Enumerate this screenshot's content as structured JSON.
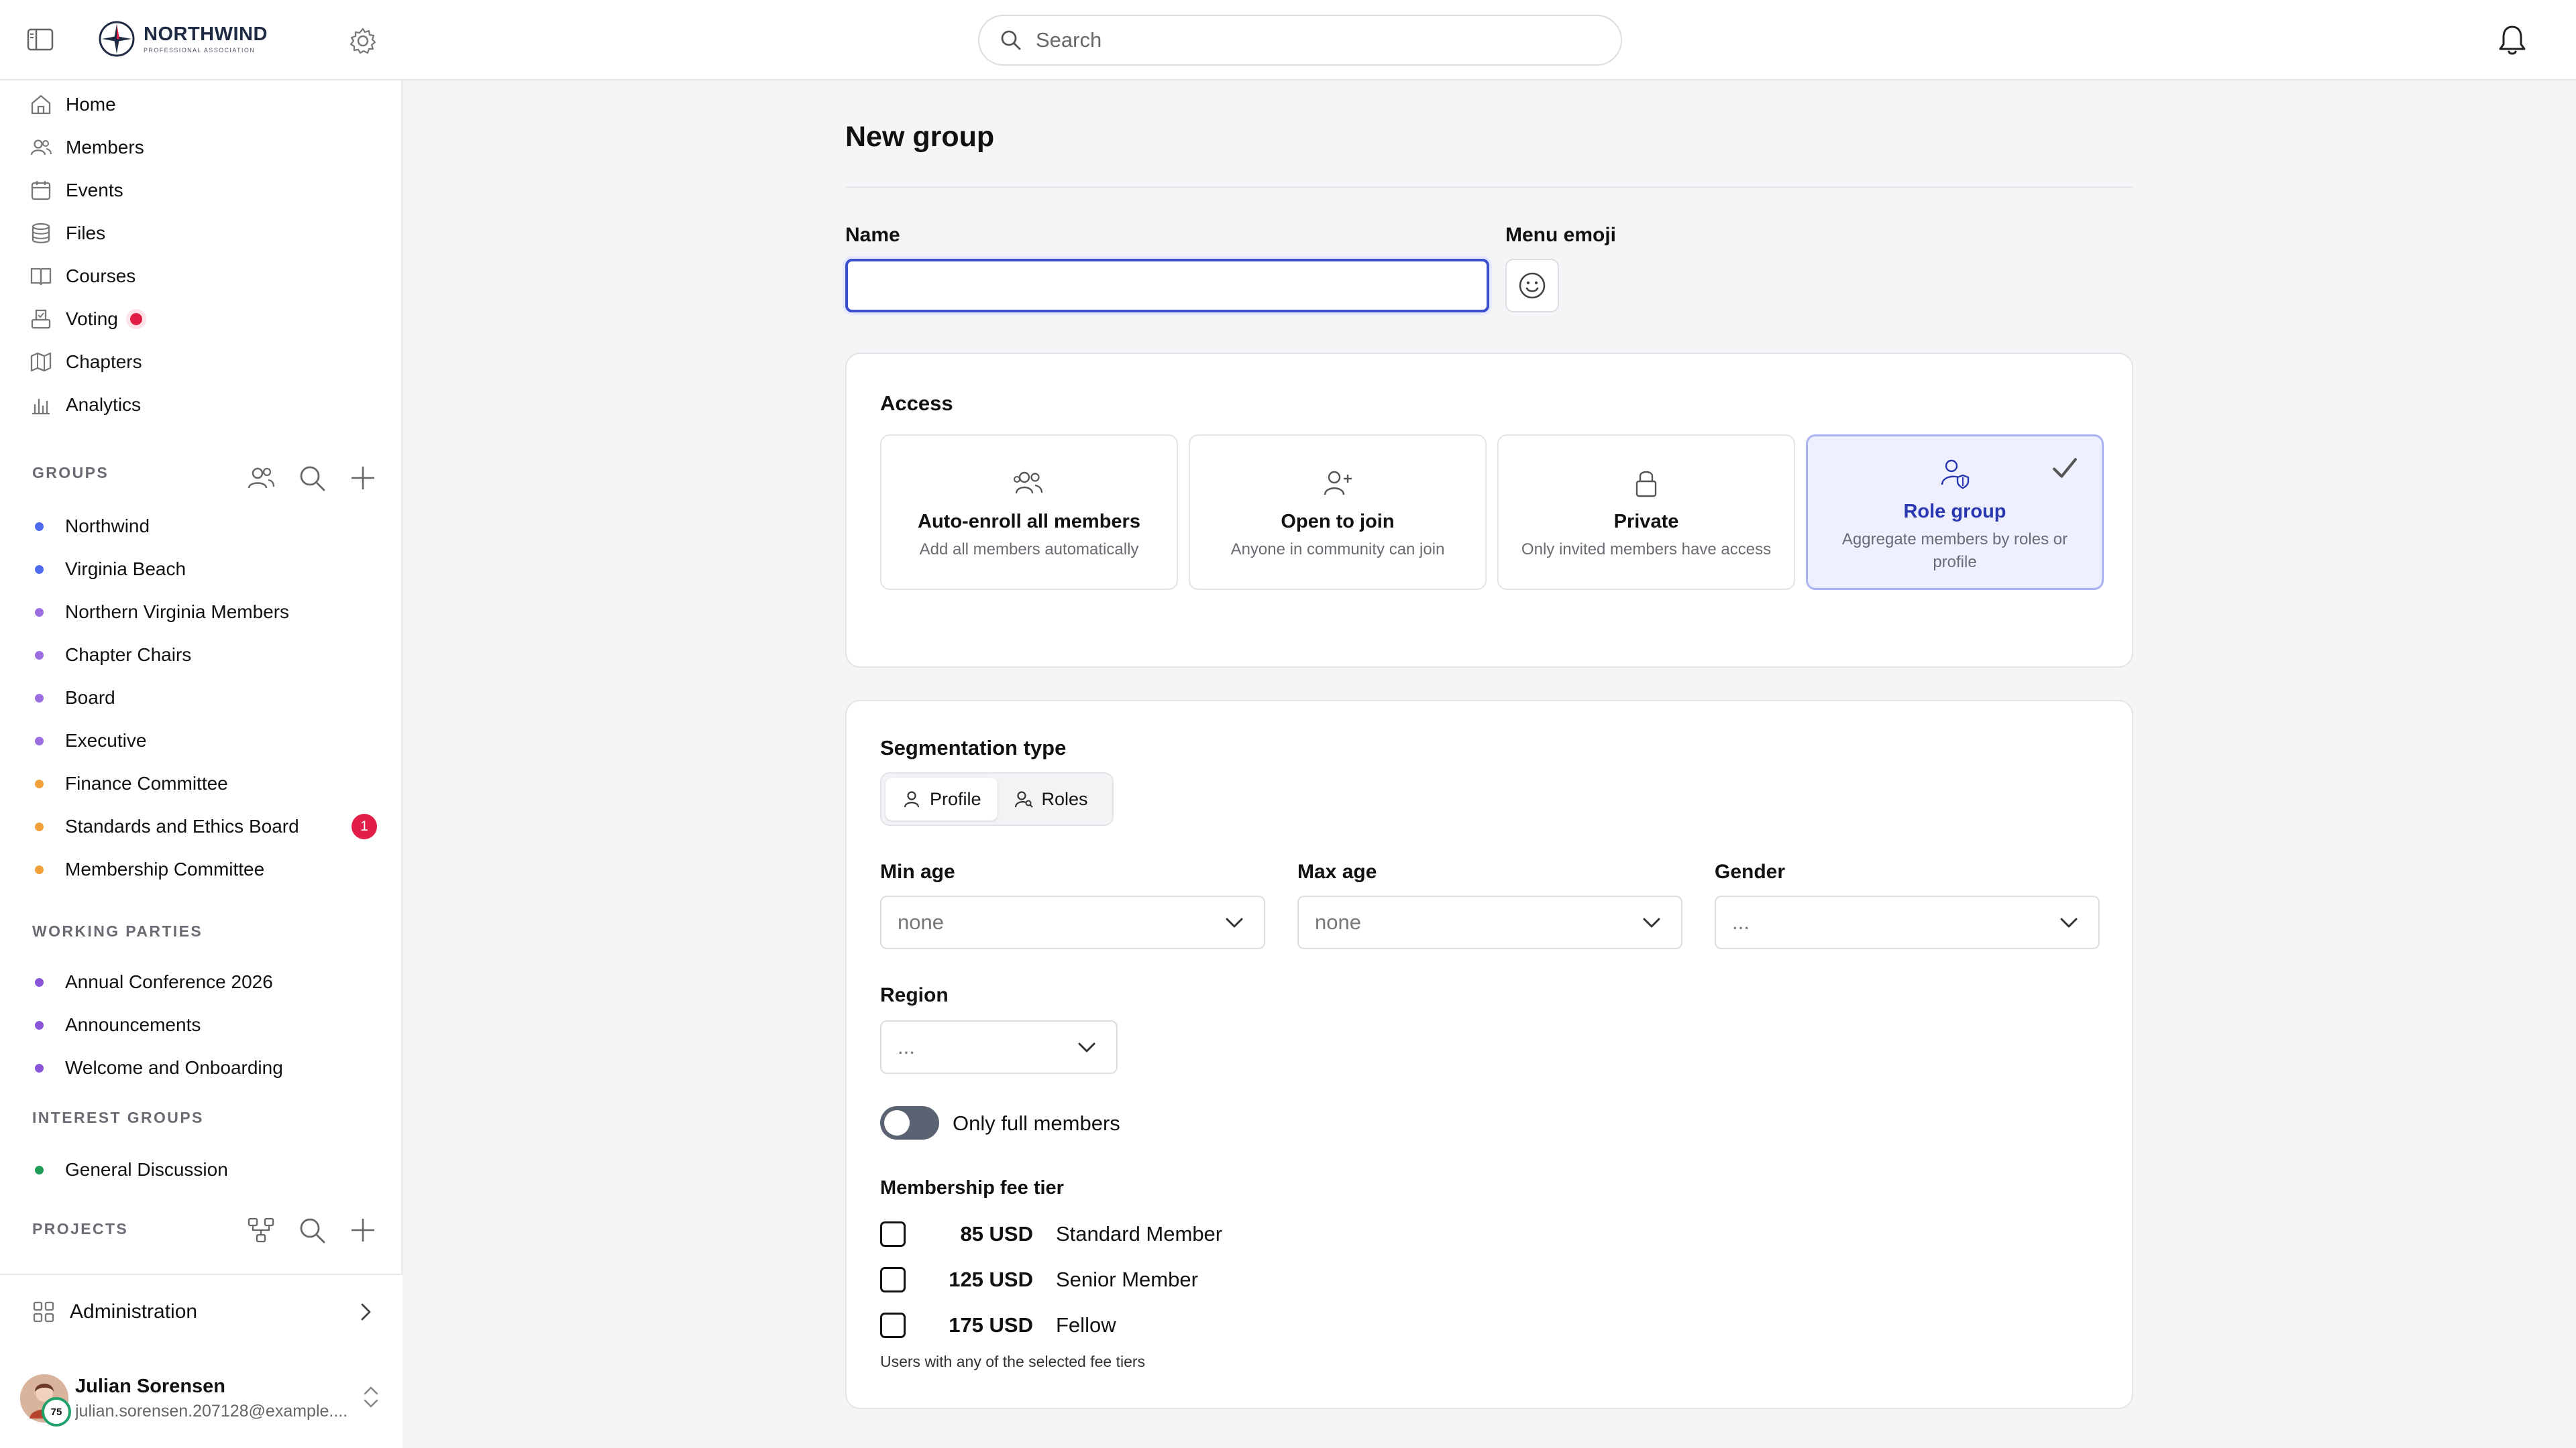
{
  "app": {
    "brand_name": "NORTHWIND",
    "brand_subtitle": "PROFESSIONAL ASSOCIATION",
    "search_placeholder": "Search"
  },
  "nav": [
    {
      "label": "Home",
      "icon": "home-icon"
    },
    {
      "label": "Members",
      "icon": "members-icon"
    },
    {
      "label": "Events",
      "icon": "calendar-icon"
    },
    {
      "label": "Files",
      "icon": "database-icon"
    },
    {
      "label": "Courses",
      "icon": "book-icon"
    },
    {
      "label": "Voting",
      "icon": "ballot-icon",
      "has_alert": true
    },
    {
      "label": "Chapters",
      "icon": "map-icon"
    },
    {
      "label": "Analytics",
      "icon": "chart-icon"
    }
  ],
  "sections": {
    "groups": {
      "label": "GROUPS",
      "items": [
        {
          "label": "Northwind",
          "color": "#4f6bed"
        },
        {
          "label": "Virginia Beach",
          "color": "#4f6bed"
        },
        {
          "label": "Northern Virginia Members",
          "color": "#9b6fe0"
        },
        {
          "label": "Chapter Chairs",
          "color": "#9b6fe0"
        },
        {
          "label": "Board",
          "color": "#9b6fe0"
        },
        {
          "label": "Executive",
          "color": "#9b6fe0"
        },
        {
          "label": "Finance Committee",
          "color": "#f0a13a"
        },
        {
          "label": "Standards and Ethics Board",
          "color": "#f0a13a",
          "badge": "1"
        },
        {
          "label": "Membership Committee",
          "color": "#f0a13a"
        }
      ]
    },
    "working_parties": {
      "label": "WORKING PARTIES",
      "items": [
        {
          "label": "Annual Conference 2026",
          "color": "#8a55d8"
        },
        {
          "label": "Announcements",
          "color": "#8a55d8"
        },
        {
          "label": "Welcome and Onboarding",
          "color": "#8a55d8"
        }
      ]
    },
    "interest_groups": {
      "label": "INTEREST GROUPS",
      "items": [
        {
          "label": "General Discussion",
          "color": "#1f9d55"
        }
      ]
    },
    "projects": {
      "label": "PROJECTS"
    }
  },
  "footer": {
    "admin_label": "Administration",
    "user_name": "Julian Sorensen",
    "user_email": "julian.sorensen.207128@example....",
    "user_badge": "75"
  },
  "form": {
    "title": "New group",
    "name_label": "Name",
    "name_value": "",
    "emoji_label": "Menu emoji",
    "access": {
      "title": "Access",
      "options": [
        {
          "title": "Auto-enroll all members",
          "desc": "Add all members automatically",
          "icon": "members-icon",
          "selected": false
        },
        {
          "title": "Open to join",
          "desc": "Anyone in community can join",
          "icon": "user-plus-icon",
          "selected": false
        },
        {
          "title": "Private",
          "desc": "Only invited members have access",
          "icon": "lock-icon",
          "selected": false
        },
        {
          "title": "Role group",
          "desc": "Aggregate members by roles or profile",
          "icon": "user-shield-icon",
          "selected": true
        }
      ]
    },
    "segmentation": {
      "title": "Segmentation type",
      "tabs": [
        {
          "label": "Profile",
          "active": true
        },
        {
          "label": "Roles",
          "active": false
        }
      ],
      "min_age_label": "Min age",
      "min_age_value": "none",
      "max_age_label": "Max age",
      "max_age_value": "none",
      "gender_label": "Gender",
      "gender_value": "...",
      "region_label": "Region",
      "region_value": "...",
      "full_members_label": "Only full members",
      "full_members_on": false,
      "fee_tier_label": "Membership fee tier",
      "fee_tiers": [
        {
          "amount": "85 USD",
          "name": "Standard Member",
          "checked": false
        },
        {
          "amount": "125 USD",
          "name": "Senior Member",
          "checked": false
        },
        {
          "amount": "175 USD",
          "name": "Fellow",
          "checked": false
        }
      ],
      "fee_help": "Users with any of the selected fee tiers"
    }
  },
  "colors": {
    "accent": "#3b4ecb",
    "selected_bg": "#eef0ff",
    "alert": "#e11d48"
  }
}
